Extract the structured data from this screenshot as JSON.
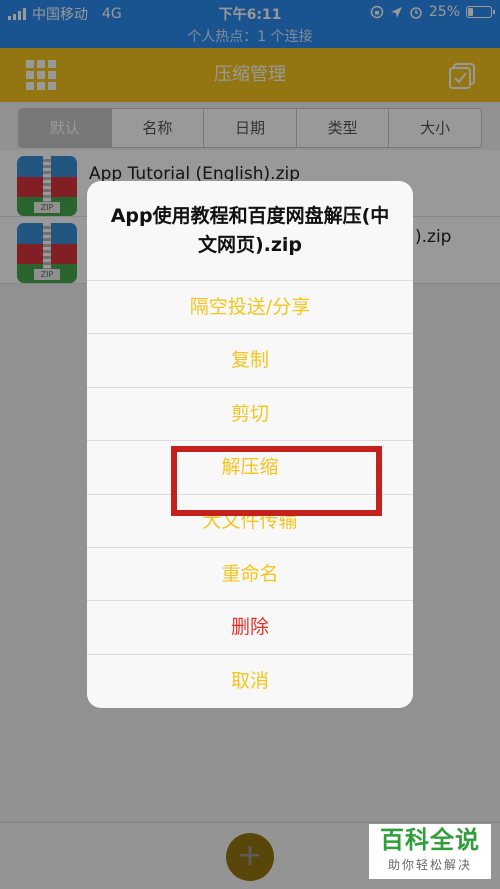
{
  "status_bar": {
    "carrier": "中国移动",
    "network": "4G",
    "time": "下午6:11",
    "battery": "25%",
    "battery_level": 0.25,
    "hotspot": "个人热点：1 个连接"
  },
  "nav": {
    "title": "压缩管理"
  },
  "sort_tabs": [
    {
      "label": "默认"
    },
    {
      "label": "名称"
    },
    {
      "label": "日期"
    },
    {
      "label": "类型"
    },
    {
      "label": "大小"
    }
  ],
  "files": [
    {
      "name": "App Tutorial (English).zip",
      "icon_label": "ZIP"
    },
    {
      "name": ").zip",
      "icon_label": "ZIP"
    }
  ],
  "dialog": {
    "title": "App使用教程和百度网盘解压(中文网页).zip",
    "actions": [
      {
        "label": "隔空投送/分享"
      },
      {
        "label": "复制"
      },
      {
        "label": "剪切"
      },
      {
        "label": "解压缩"
      },
      {
        "label": "大文件传输"
      },
      {
        "label": "重命名"
      },
      {
        "label": "删除"
      },
      {
        "label": "取消"
      }
    ]
  },
  "fab_label": "+",
  "watermark": {
    "main": "百科全说",
    "sub": "助你轻松解决"
  },
  "colors": {
    "status_bar": "#2b8cf0",
    "nav_bar": "#f5c51d",
    "action_text": "#f5c51d",
    "danger_text": "#e5312a",
    "highlight": "#c4201c"
  }
}
